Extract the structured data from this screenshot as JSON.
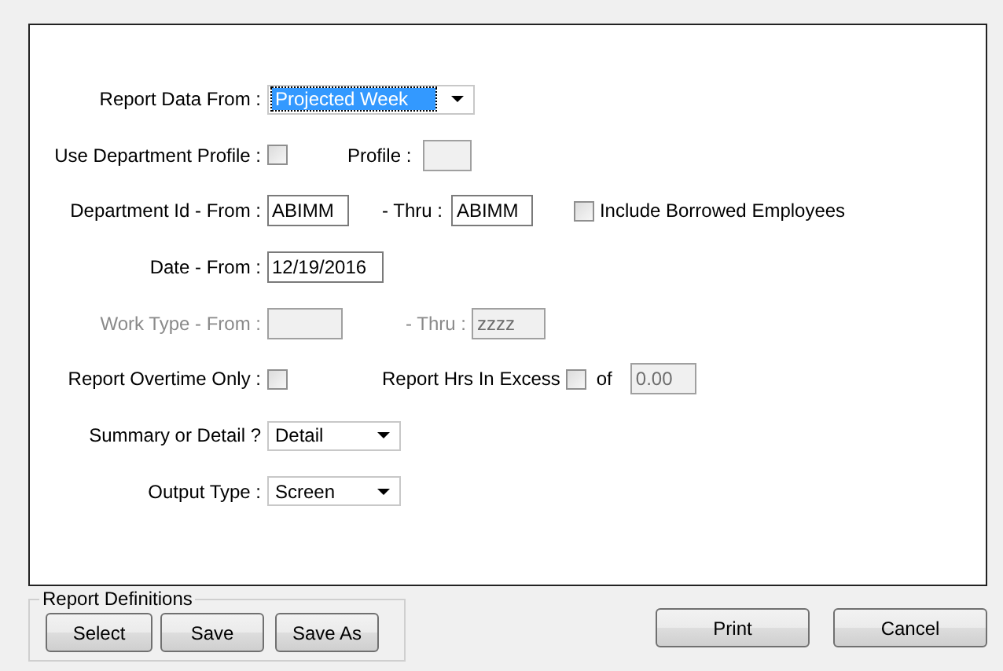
{
  "form": {
    "rows": [
      {
        "label": "Report Data From :",
        "disabled": false,
        "items": [
          {
            "kind": "select",
            "value": "Projected Week",
            "highlighted": true
          }
        ]
      },
      {
        "label": "Use Department Profile :",
        "disabled": false,
        "items": [
          {
            "kind": "checkbox",
            "checked": false
          },
          {
            "kind": "text",
            "text": "Profile :",
            "disabled": false
          },
          {
            "kind": "input",
            "value": "",
            "disabled": true
          }
        ]
      },
      {
        "label": "Department Id - From :",
        "disabled": false,
        "items": [
          {
            "kind": "input",
            "value": "ABIMM",
            "disabled": false
          },
          {
            "kind": "text",
            "text": "- Thru :",
            "disabled": false
          },
          {
            "kind": "input",
            "value": "ABIMM",
            "disabled": false
          },
          {
            "kind": "checkbox",
            "checked": false,
            "label": "Include Borrowed Employees"
          }
        ]
      },
      {
        "label": "Date - From :",
        "disabled": false,
        "items": [
          {
            "kind": "input",
            "value": "12/19/2016",
            "disabled": false
          }
        ]
      },
      {
        "label": "Work Type - From :",
        "disabled": true,
        "items": [
          {
            "kind": "input",
            "value": "",
            "disabled": true
          },
          {
            "kind": "text",
            "text": "- Thru :",
            "disabled": true
          },
          {
            "kind": "input",
            "value": "zzzz",
            "disabled": true
          }
        ]
      },
      {
        "label": "Report Overtime Only :",
        "disabled": false,
        "items": [
          {
            "kind": "checkbox",
            "checked": false
          },
          {
            "kind": "text",
            "text": "Report Hrs In Excess",
            "disabled": false
          },
          {
            "kind": "checkbox",
            "checked": false
          },
          {
            "kind": "text",
            "text": "of",
            "disabled": false
          },
          {
            "kind": "input",
            "value": "0.00",
            "disabled": true
          }
        ]
      },
      {
        "label": "Summary or Detail ?",
        "disabled": false,
        "items": [
          {
            "kind": "select",
            "value": "Detail",
            "highlighted": false
          }
        ]
      },
      {
        "label": "Output Type :",
        "disabled": false,
        "items": [
          {
            "kind": "select",
            "value": "Screen",
            "highlighted": false
          }
        ]
      }
    ]
  },
  "report_definitions": {
    "title": "Report Definitions",
    "buttons": [
      "Select",
      "Save",
      "Save As"
    ]
  },
  "actions": [
    "Print",
    "Cancel"
  ]
}
